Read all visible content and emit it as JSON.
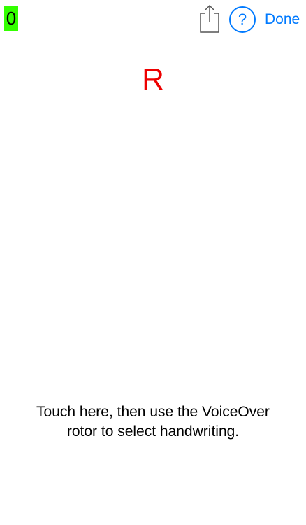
{
  "header": {
    "score": "0",
    "share_icon": "share-icon",
    "help_label": "?",
    "done_label": "Done"
  },
  "main": {
    "target_letter": "R",
    "instruction_line1": "Touch here, then use the VoiceOver",
    "instruction_line2": "rotor to select handwriting."
  },
  "colors": {
    "accent": "#007aff",
    "score_bg": "#33ff00",
    "letter": "#ee0000",
    "background": "#ffffff"
  }
}
